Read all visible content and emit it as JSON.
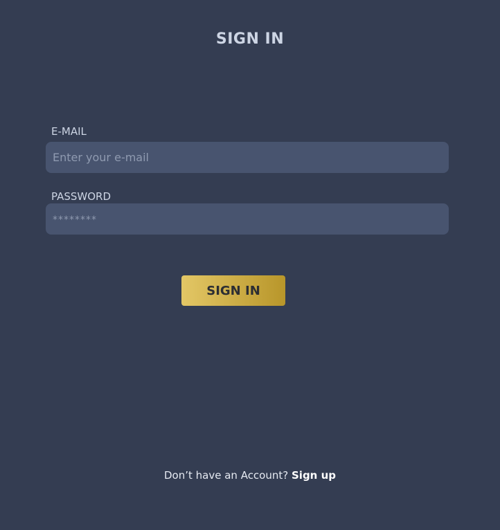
{
  "header": {
    "title": "SIGN IN"
  },
  "form": {
    "email": {
      "label": "E-MAIL",
      "placeholder": "Enter your e-mail",
      "value": ""
    },
    "password": {
      "label": "PASSWORD",
      "placeholder": "********",
      "value": ""
    },
    "submit_label": "SIGN IN"
  },
  "footer": {
    "prompt": "Don’t have an Account?",
    "signup_label": "Sign up"
  },
  "colors": {
    "background": "#343d52",
    "input_background": "#48546f",
    "button_gradient_start": "#e3c766",
    "button_gradient_end": "#b8962a"
  }
}
